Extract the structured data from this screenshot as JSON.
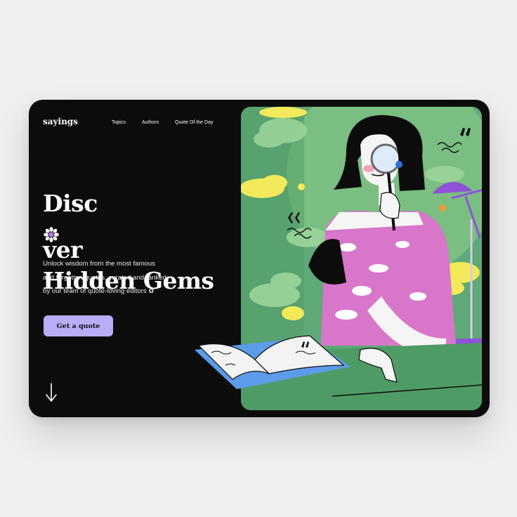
{
  "app": {
    "logo": "sayings"
  },
  "nav": {
    "items": [
      "Topics",
      "Authors",
      "Quote Of the Day"
    ]
  },
  "hero": {
    "headline_line1_prefix": "Disc",
    "headline_line1_suffix": "ver",
    "headline_line2": "Hidden Gems",
    "subtitle": [
      "Unlock wisdom from the most famous",
      "and forgotten quotes, curated and ranked",
      "by our team of quote-loving editors ✿"
    ],
    "cta_label": "Get a quote"
  },
  "icons": {
    "scroll": "arrow-down-icon",
    "flower": "flower-icon",
    "quote_marks": "quote-mark-icon"
  },
  "colors": {
    "card_bg": "#0c0c0c",
    "cta_bg": "#b7aef7",
    "illustration_green": "#5fa877",
    "pink": "#d877c9",
    "yellow": "#f2ea5a",
    "purple": "#8f52d9"
  }
}
